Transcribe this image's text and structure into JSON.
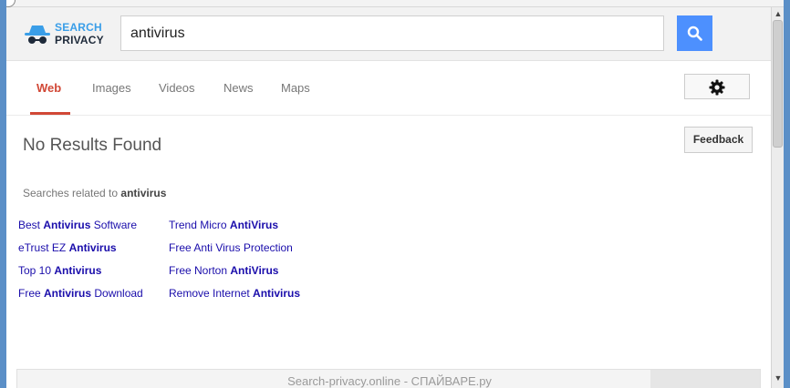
{
  "logo": {
    "line1": "SEARCH",
    "line2": "PRIVACY"
  },
  "search": {
    "value": "antivirus"
  },
  "tabs": [
    {
      "label": "Web",
      "active": true
    },
    {
      "label": "Images",
      "active": false
    },
    {
      "label": "Videos",
      "active": false
    },
    {
      "label": "News",
      "active": false
    },
    {
      "label": "Maps",
      "active": false
    }
  ],
  "results": {
    "no_results": "No Results Found",
    "feedback_label": "Feedback"
  },
  "related": {
    "prefix": "Searches related to",
    "term": "antivirus",
    "left": [
      {
        "pre": "Best ",
        "bold": "Antivirus",
        "post": " Software"
      },
      {
        "pre": "eTrust EZ ",
        "bold": "Antivirus",
        "post": ""
      },
      {
        "pre": "Top 10 ",
        "bold": "Antivirus",
        "post": ""
      },
      {
        "pre": "Free ",
        "bold": "Antivirus",
        "post": " Download"
      }
    ],
    "right": [
      {
        "pre": "Trend Micro ",
        "bold": "AntiVirus",
        "post": ""
      },
      {
        "pre": "Free Anti Virus Protection",
        "bold": "",
        "post": ""
      },
      {
        "pre": "Free Norton ",
        "bold": "AntiVirus",
        "post": ""
      },
      {
        "pre": "Remove Internet ",
        "bold": "Antivirus",
        "post": ""
      }
    ]
  },
  "watermark": "Search-privacy.online - СПАЙВАРЕ.ру",
  "icons": {
    "logo": "incognito-icon",
    "search": "magnifier-icon",
    "settings": "gear-icon",
    "scroll_up": "arrow-up-icon",
    "scroll_down": "arrow-down-icon"
  },
  "colors": {
    "accent": "#d14836",
    "search_button": "#4d90fe",
    "link": "#1a0dab",
    "logo_blue": "#3a9ee8"
  }
}
